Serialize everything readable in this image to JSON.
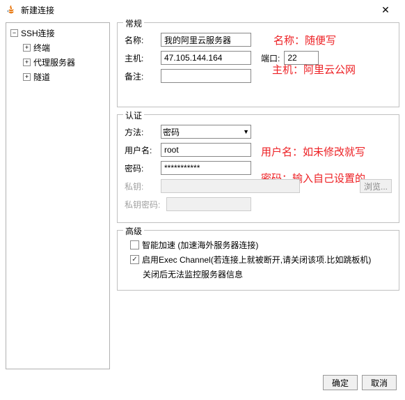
{
  "window": {
    "title": "新建连接",
    "close": "✕"
  },
  "tree": {
    "root": "SSH连接",
    "children": [
      "终端",
      "代理服务器",
      "隧道"
    ]
  },
  "general": {
    "legend": "常规",
    "name_label": "名称:",
    "name_value": "我的阿里云服务器",
    "name_anno": "名称：随便写",
    "host_label": "主机:",
    "host_value": "47.105.144.164",
    "port_label": "端口:",
    "port_value": "22",
    "host_anno": "主机：阿里云公网",
    "remark_label": "备注:",
    "remark_value": ""
  },
  "auth": {
    "legend": "认证",
    "method_label": "方法:",
    "method_value": "密码",
    "user_label": "用户名:",
    "user_value": "root",
    "user_anno": "用户名：如未修改就写",
    "pass_label": "密码:",
    "pass_value": "***********",
    "pass_anno": "密码：输入自己设置的",
    "key_label": "私钥:",
    "key_value": "",
    "browse": "浏览...",
    "keypass_label": "私钥密码:",
    "keypass_value": ""
  },
  "advanced": {
    "legend": "高级",
    "accel_label": "智能加速 (加速海外服务器连接)",
    "exec_label": "启用Exec Channel(若连接上就被断开,请关闭该项.比如跳板机)",
    "exec_note": "关闭后无法监控服务器信息"
  },
  "buttons": {
    "ok": "确定",
    "cancel": "取消"
  }
}
